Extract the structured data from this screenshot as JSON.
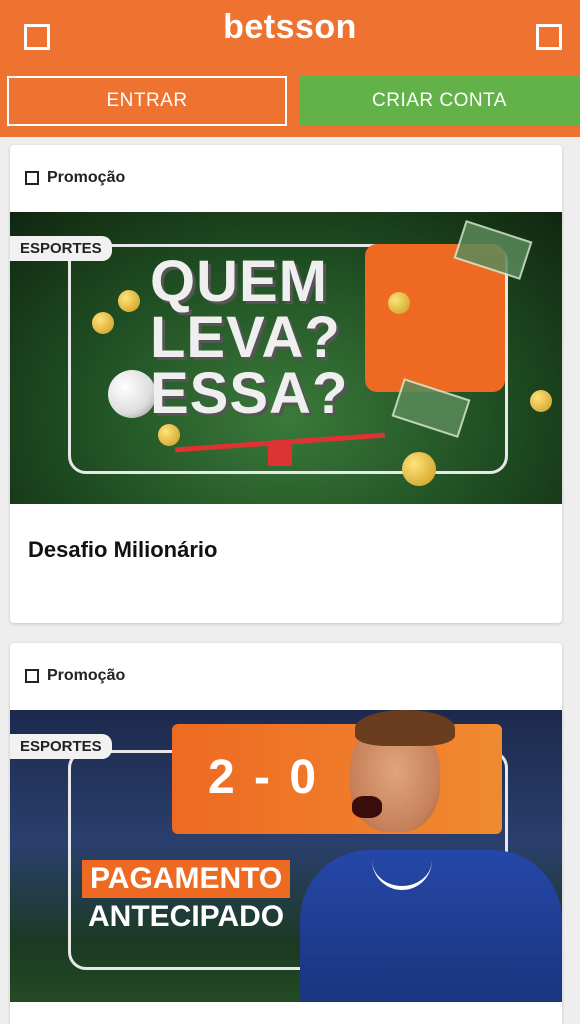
{
  "header": {
    "brand": "betsson",
    "login_label": "ENTRAR",
    "signup_label": "CRIAR CONTA",
    "colors": {
      "header_bg": "#ee7330",
      "signup_bg": "#63b249"
    }
  },
  "promotions": [
    {
      "type_label": "Promoção",
      "category": "ESPORTES",
      "banner_text": [
        "QUEM",
        "LEVA?",
        "ESSA?"
      ],
      "title": "Desafio Milionário"
    },
    {
      "type_label": "Promoção",
      "category": "ESPORTES",
      "banner_score": "2 - 0",
      "banner_line1": "PAGAMENTO",
      "banner_line2": "ANTECIPADO"
    }
  ]
}
